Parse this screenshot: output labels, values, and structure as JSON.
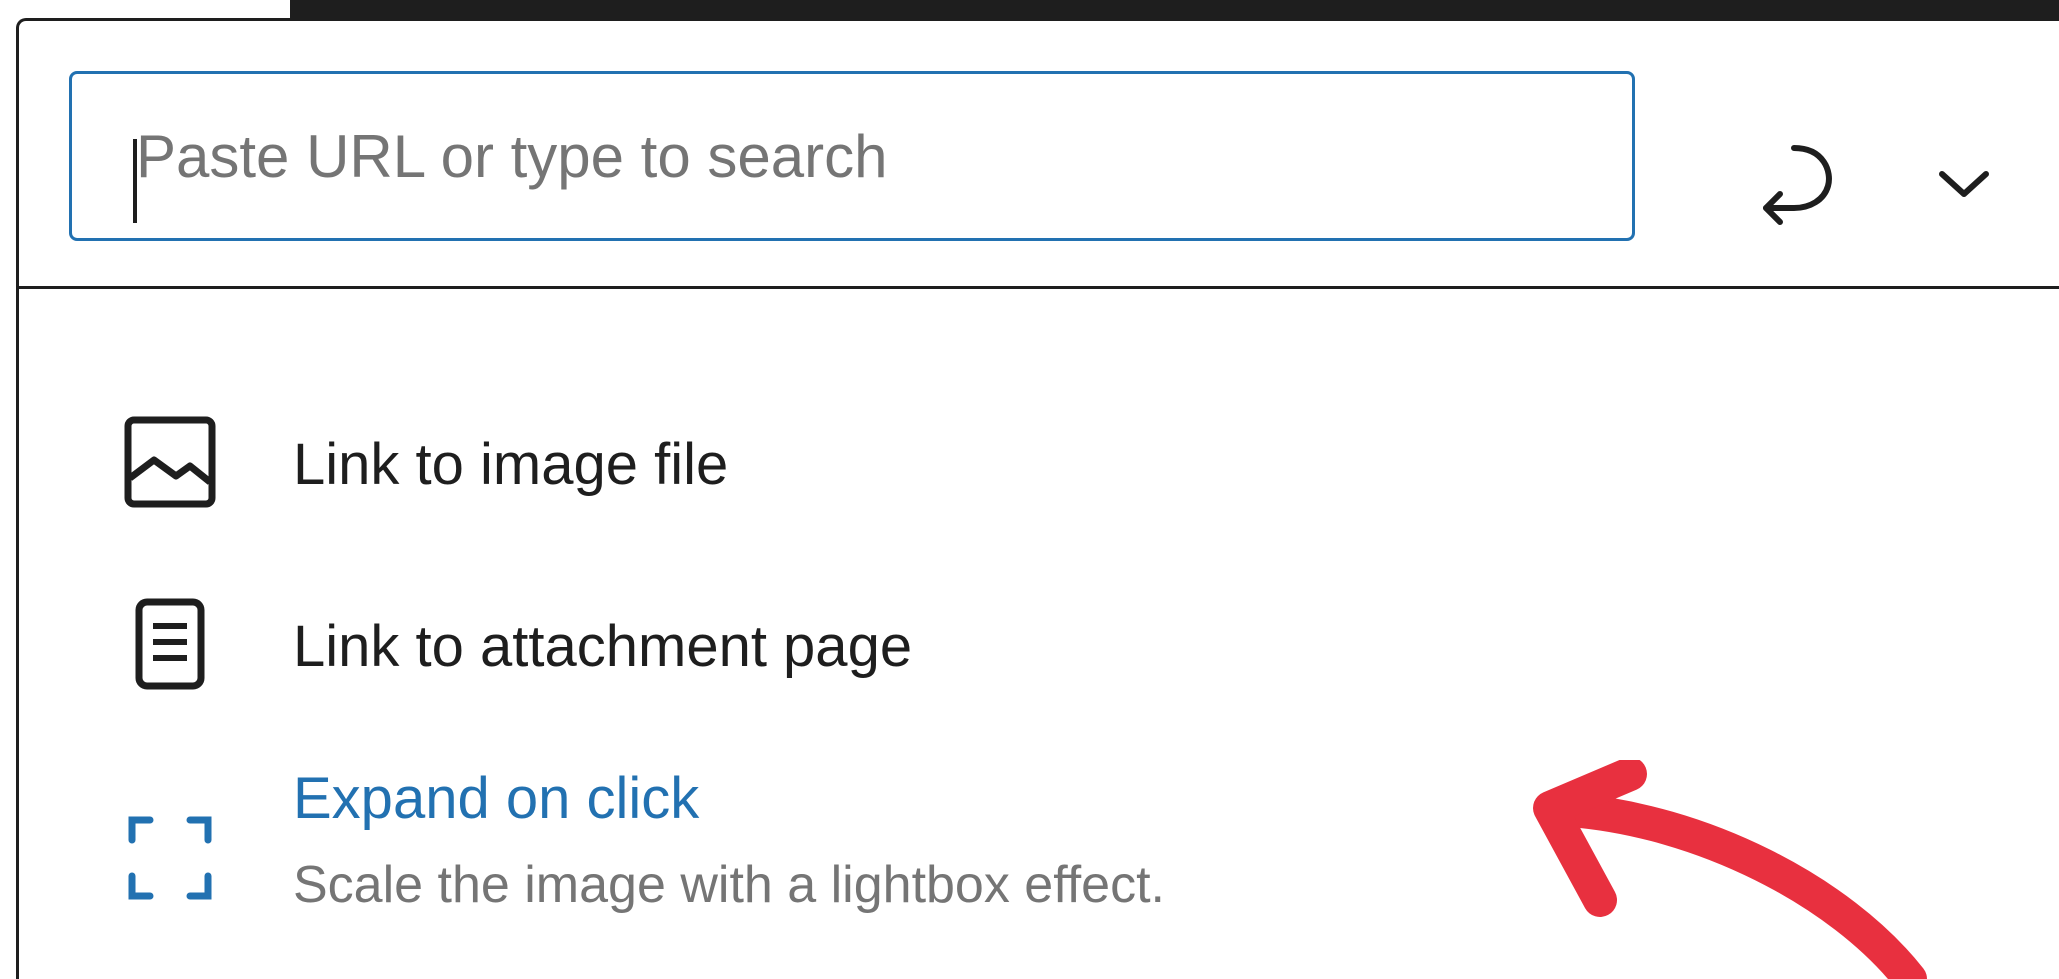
{
  "search": {
    "placeholder": "Paste URL or type to search",
    "value": ""
  },
  "options": [
    {
      "icon": "image-icon",
      "label": "Link to image file",
      "description": "",
      "active": false
    },
    {
      "icon": "page-icon",
      "label": "Link to attachment page",
      "description": "",
      "active": false
    },
    {
      "icon": "expand-icon",
      "label": "Expand on click",
      "description": "Scale the image with a lightbox effect.",
      "active": true
    }
  ],
  "colors": {
    "accent": "#2271b1",
    "text": "#1e1e1e",
    "muted": "#757575",
    "annotation_arrow": "#e8303f"
  },
  "icons": {
    "submit": "enter-icon",
    "toggle": "chevron-down-icon"
  }
}
